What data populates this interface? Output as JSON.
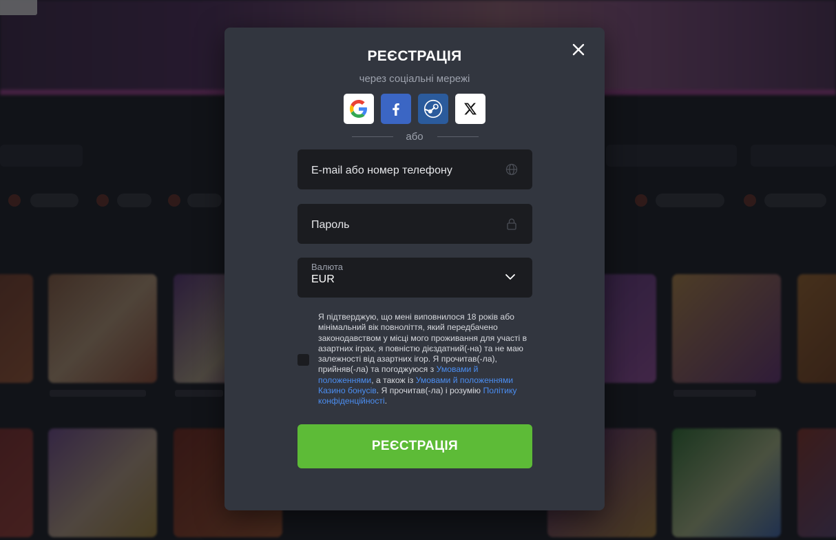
{
  "modal": {
    "title": "РЕЄСТРАЦІЯ",
    "subtitle": "через соціальні мережі",
    "social": [
      {
        "name": "google",
        "icon": "google-icon",
        "color": "#ffffff"
      },
      {
        "name": "facebook",
        "icon": "facebook-icon",
        "color": "#3b66c4"
      },
      {
        "name": "steam",
        "icon": "steam-icon",
        "color": "#2b5b9c"
      },
      {
        "name": "x",
        "icon": "x-icon",
        "color": "#ffffff"
      }
    ],
    "divider_text": "або",
    "email_field": {
      "placeholder": "E-mail або номер телефону",
      "icon": "globe-icon"
    },
    "password_field": {
      "placeholder": "Пароль",
      "icon": "lock-icon"
    },
    "currency_field": {
      "label": "Валюта",
      "value": "EUR",
      "icon": "chevron-down-icon"
    },
    "consent": {
      "checked": false,
      "text_1": "Я підтверджую, що мені виповнилося 18 років або мінімальний вік повноліття, який передбачено законодавством у місці мого проживання для участі в азартних іграх, я повністю дієздатний(-на) та не маю залежності від азартних ігор. Я прочитав(-ла), прийняв(-ла) та погоджуюся з ",
      "link_1": "Умовами й положеннями",
      "text_2": ", а також із ",
      "link_2": "Умовами й положеннями Казино бонусів",
      "text_3": ". Я прочитав(-ла) і розумію ",
      "link_3": "Політику конфіденційності",
      "text_4": "."
    },
    "submit_label": "РЕЄСТРАЦІЯ",
    "colors": {
      "modal_bg": "#32363f",
      "field_bg": "#1b1c20",
      "accent_green": "#5dbb37",
      "link_blue": "#4b8ef2"
    }
  }
}
